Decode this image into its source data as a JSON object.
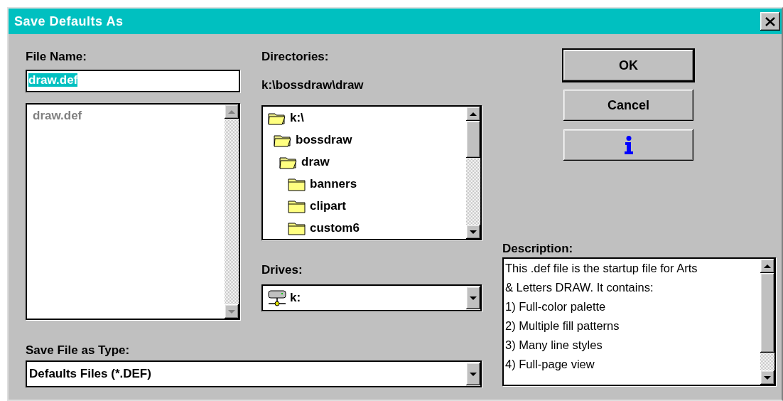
{
  "window": {
    "title": "Save Defaults As"
  },
  "file_name": {
    "label": "File Name:",
    "value": "draw.def",
    "selected": true
  },
  "file_list": {
    "items": [
      {
        "name": "draw.def",
        "disabled": true
      }
    ]
  },
  "directories": {
    "label": "Directories:",
    "path": "k:\\bossdraw\\draw",
    "tree": [
      {
        "name": "k:\\",
        "expanded": true,
        "children": [
          {
            "name": "bossdraw",
            "expanded": true,
            "children": [
              {
                "name": "draw",
                "expanded": true,
                "children": [
                  {
                    "name": "banners",
                    "expanded": false
                  },
                  {
                    "name": "clipart",
                    "expanded": false
                  },
                  {
                    "name": "custom6",
                    "expanded": false
                  }
                ]
              }
            ]
          }
        ]
      }
    ]
  },
  "drives": {
    "label": "Drives:",
    "value": "k:"
  },
  "file_type": {
    "label": "Save File as Type:",
    "value": "Defaults Files (*.DEF)"
  },
  "buttons": [
    {
      "kind": "text",
      "label": "OK",
      "default": true
    },
    {
      "kind": "text",
      "label": "Cancel",
      "default": false
    },
    {
      "kind": "info",
      "default": false
    }
  ],
  "description": {
    "label": "Description:",
    "lines": [
      "This .def file is the startup file for Arts",
      "& Letters DRAW. It contains:",
      "1) Full-color palette",
      "2) Multiple fill patterns",
      "3) Many line styles",
      "4) Full-page view"
    ]
  }
}
